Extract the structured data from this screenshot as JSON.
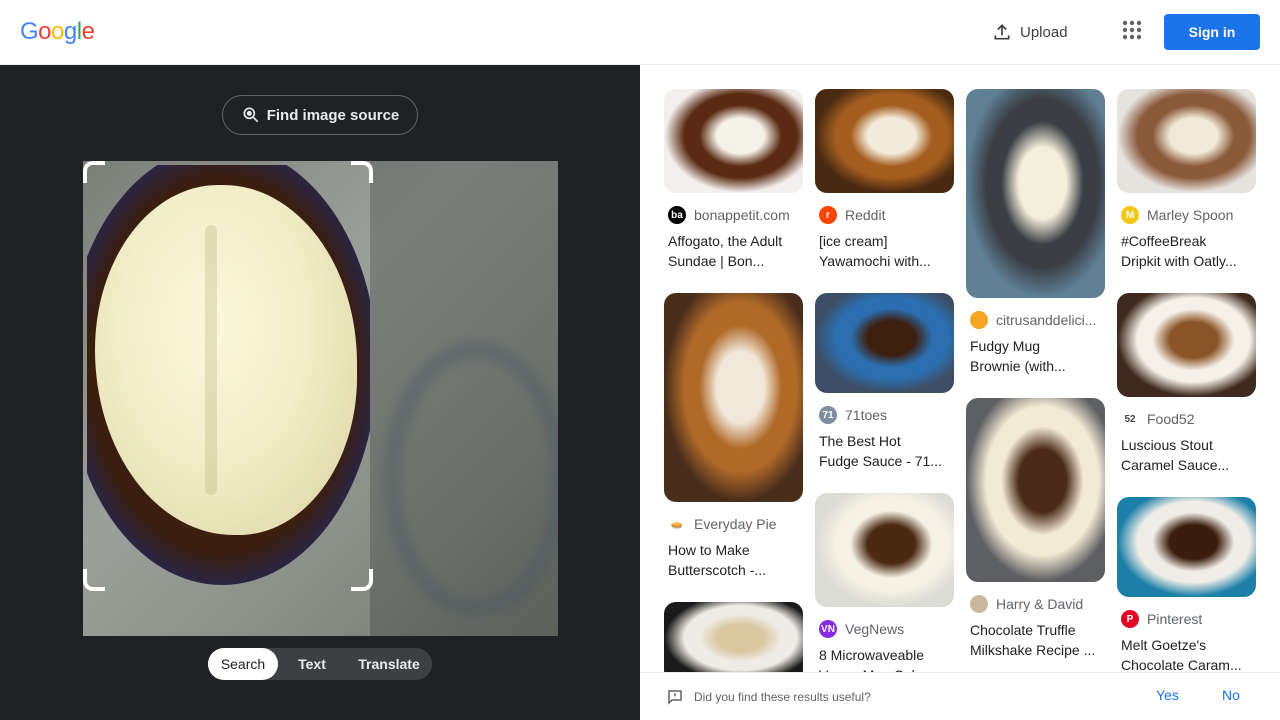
{
  "header": {
    "logo_letters": [
      {
        "ch": "G",
        "color": "#4285F4"
      },
      {
        "ch": "o",
        "color": "#EA4335"
      },
      {
        "ch": "o",
        "color": "#FBBC05"
      },
      {
        "ch": "g",
        "color": "#4285F4"
      },
      {
        "ch": "l",
        "color": "#34A853"
      },
      {
        "ch": "e",
        "color": "#EA4335"
      }
    ],
    "upload_label": "Upload",
    "signin_label": "Sign in",
    "accent": "#1a73e8"
  },
  "left_panel": {
    "find_source_label": "Find image source",
    "modes": [
      "Search",
      "Text",
      "Translate"
    ],
    "active_mode": "Search"
  },
  "results": {
    "columns": [
      [
        {
          "source": "bonappetit.com",
          "title_line1": "Affogato, the Adult",
          "title_line2": "Sundae | Bon...",
          "favicon_text": "ba",
          "favicon_color": "#000000",
          "thumb_colors": [
            "#f2efec",
            "#5a2b12",
            "#f4f1e8"
          ]
        },
        {
          "source": "Everyday Pie",
          "title_line1": "How to Make",
          "title_line2": "Butterscotch -...",
          "favicon_text": "🥧",
          "favicon_color": "#ffffff",
          "thumb_colors": [
            "#4a2e1c",
            "#b06a28",
            "#f1e8db"
          ]
        },
        {
          "source": "",
          "title_line1": "",
          "title_line2": "",
          "favicon_text": "",
          "favicon_color": "#ffffff",
          "thumb_colors": [
            "#1a1a1a",
            "#efece6",
            "#d9c8a0"
          ]
        }
      ],
      [
        {
          "source": "Reddit",
          "title_line1": "[ice cream]",
          "title_line2": "Yawamochi with...",
          "favicon_text": "r",
          "favicon_color": "#FF4500",
          "thumb_colors": [
            "#4a2b12",
            "#a35d1e",
            "#f4ecda"
          ]
        },
        {
          "source": "71toes",
          "title_line1": "The Best Hot",
          "title_line2": "Fudge Sauce - 71...",
          "favicon_text": "71",
          "favicon_color": "#7f8fa3",
          "thumb_colors": [
            "#3c4f66",
            "#2b6fb0",
            "#3d1f0e"
          ]
        },
        {
          "source": "VegNews",
          "title_line1": "8 Microwaveable",
          "title_line2": "Vegan Mug Cakes...",
          "favicon_text": "VN",
          "favicon_color": "#8a2be2",
          "thumb_colors": [
            "#dcdcd6",
            "#f5f1e4",
            "#4b2a14"
          ]
        }
      ],
      [
        {
          "source": "citrusanddelici...",
          "title_line1": "Fudgy Mug",
          "title_line2": "Brownie (with...",
          "favicon_text": "",
          "favicon_color": "#f5a623",
          "thumb_colors": [
            "#5e7f94",
            "#3b3f44",
            "#f4efdc"
          ]
        },
        {
          "source": "Harry & David",
          "title_line1": "Chocolate Truffle",
          "title_line2": "Milkshake Recipe ...",
          "favicon_text": "",
          "favicon_color": "#c9b8a0",
          "thumb_colors": [
            "#5d5f62",
            "#f2ead4",
            "#4a2b1a"
          ]
        }
      ],
      [
        {
          "source": "Marley Spoon",
          "title_line1": "#CoffeeBreak",
          "title_line2": "Dripkit with Oatly...",
          "favicon_text": "M",
          "favicon_color": "#f5c518",
          "thumb_colors": [
            "#e6e3df",
            "#8a5a3a",
            "#f1ead6"
          ]
        },
        {
          "source": "Food52",
          "title_line1": "Luscious Stout",
          "title_line2": "Caramel Sauce...",
          "favicon_text": "52",
          "favicon_color": "#ffffff",
          "thumb_colors": [
            "#3e2a1e",
            "#f5f0e8",
            "#8a5526"
          ]
        },
        {
          "source": "Pinterest",
          "title_line1": "Melt Goetze's",
          "title_line2": "Chocolate Caram...",
          "favicon_text": "P",
          "favicon_color": "#E60023",
          "thumb_colors": [
            "#1c7fa8",
            "#f0ede6",
            "#3a1d0c"
          ]
        }
      ]
    ]
  },
  "feedback": {
    "question": "Did you find these results useful?",
    "yes_label": "Yes",
    "no_label": "No"
  }
}
